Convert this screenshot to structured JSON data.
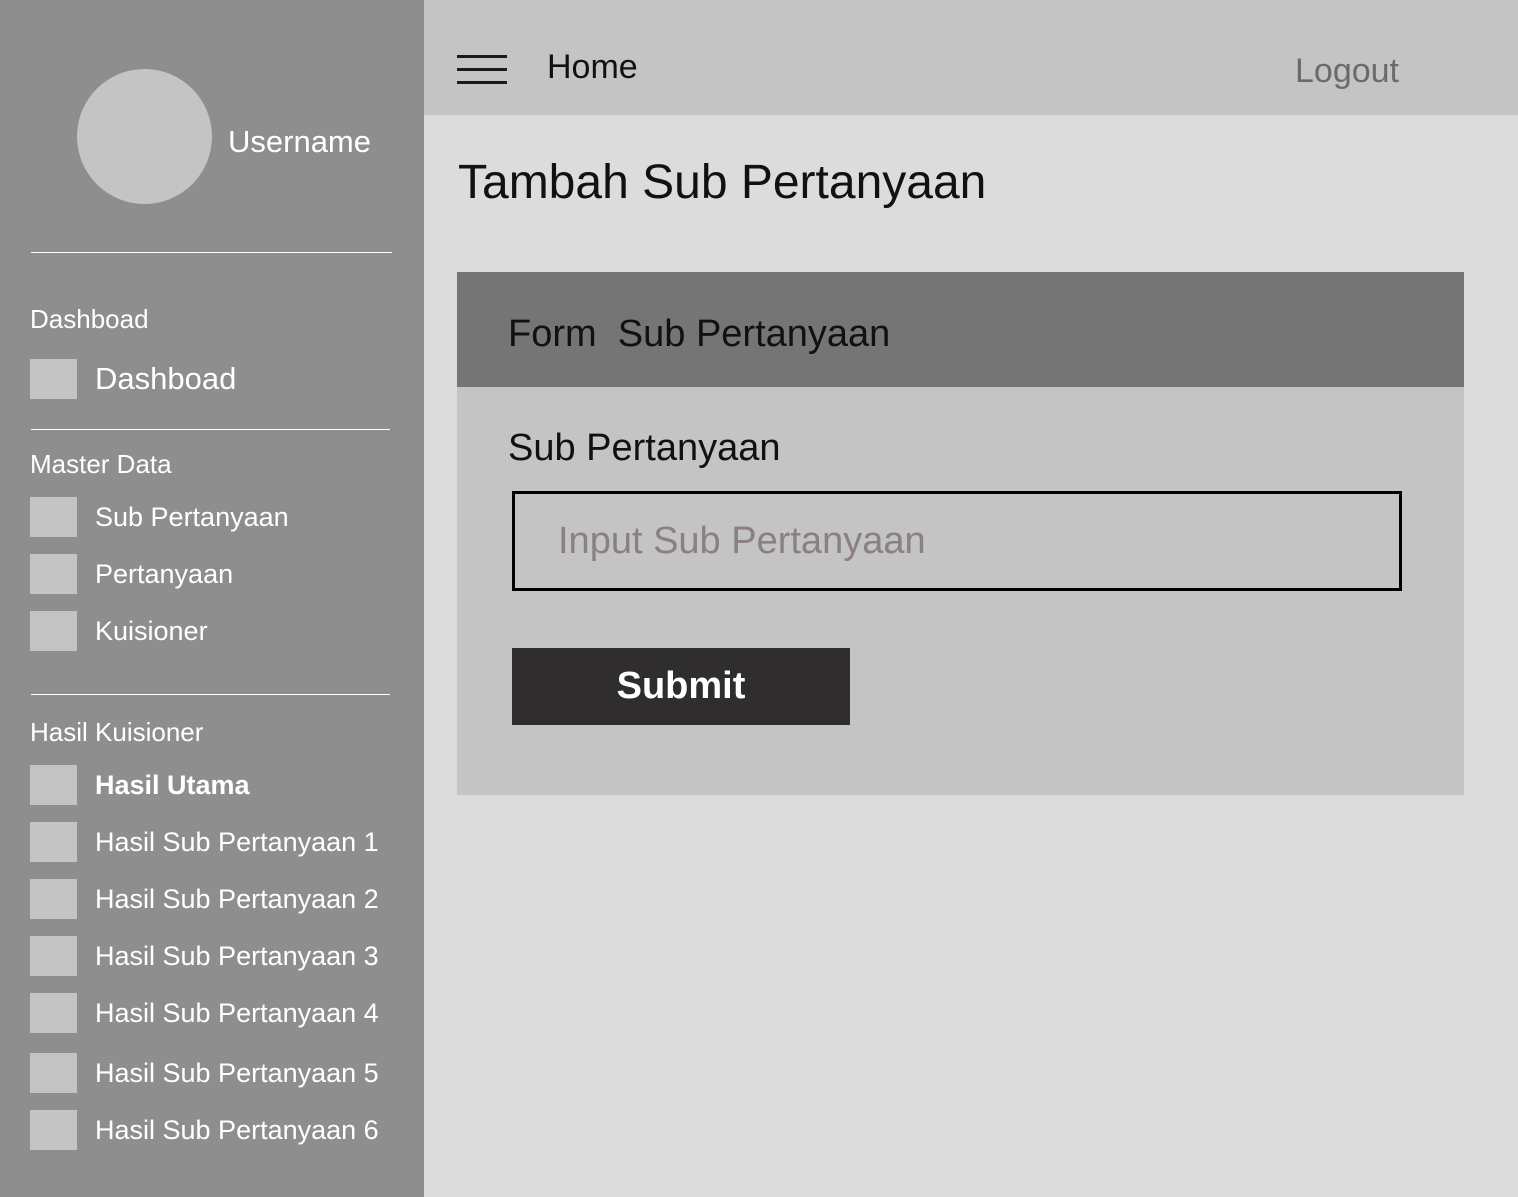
{
  "sidebar": {
    "username": "Username",
    "sections": [
      {
        "title": "Dashboad",
        "items": [
          {
            "label": "Dashboad",
            "icon": "dashboard-icon"
          }
        ]
      },
      {
        "title": "Master Data",
        "items": [
          {
            "label": "Sub Pertanyaan",
            "icon": "sub-pertanyaan-icon"
          },
          {
            "label": "Pertanyaan",
            "icon": "pertanyaan-icon"
          },
          {
            "label": "Kuisioner",
            "icon": "kuisioner-icon"
          }
        ]
      },
      {
        "title": "Hasil Kuisioner",
        "items": [
          {
            "label": "Hasil Utama",
            "icon": "hasil-utama-icon"
          },
          {
            "label": "Hasil Sub Pertanyaan 1",
            "icon": "hasil-icon"
          },
          {
            "label": "Hasil Sub Pertanyaan 2",
            "icon": "hasil-icon"
          },
          {
            "label": "Hasil Sub Pertanyaan 3",
            "icon": "hasil-icon"
          },
          {
            "label": "Hasil Sub Pertanyaan 4",
            "icon": "hasil-icon"
          },
          {
            "label": "Hasil Sub Pertanyaan 5",
            "icon": "hasil-icon"
          },
          {
            "label": "Hasil Sub Pertanyaan 6",
            "icon": "hasil-icon"
          }
        ]
      }
    ]
  },
  "topbar": {
    "menu_icon": "hamburger-menu-icon",
    "home_label": "Home",
    "logout_label": "Logout"
  },
  "main": {
    "page_title": "Tambah Sub Pertanyaan",
    "form": {
      "title": "Form  Sub Pertanyaan",
      "field_label": "Sub Pertanyaan",
      "input_placeholder": "Input Sub Pertanyaan",
      "input_value": "",
      "submit_label": "Submit"
    }
  },
  "colors": {
    "sidebar_bg": "#8e8e8e",
    "topbar_bg": "#c4c4c4",
    "page_bg": "#dddcdd",
    "card_header_bg": "#757575",
    "submit_bg": "#2f2d2e"
  }
}
